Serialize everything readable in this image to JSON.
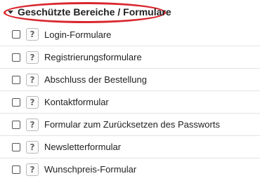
{
  "section": {
    "title": "Geschützte Bereiche / Formulare",
    "toggle_icon": "caret-down-icon",
    "highlight_color": "#d9272e"
  },
  "help_glyph": "?",
  "items": [
    {
      "label": "Login-Formulare",
      "checked": false
    },
    {
      "label": "Registrierungsformulare",
      "checked": false
    },
    {
      "label": "Abschluss der Bestellung",
      "checked": false
    },
    {
      "label": "Kontaktformular",
      "checked": false
    },
    {
      "label": "Formular zum Zurücksetzen des Passworts",
      "checked": false
    },
    {
      "label": "Newsletterformular",
      "checked": false
    },
    {
      "label": "Wunschpreis-Formular",
      "checked": false
    }
  ]
}
